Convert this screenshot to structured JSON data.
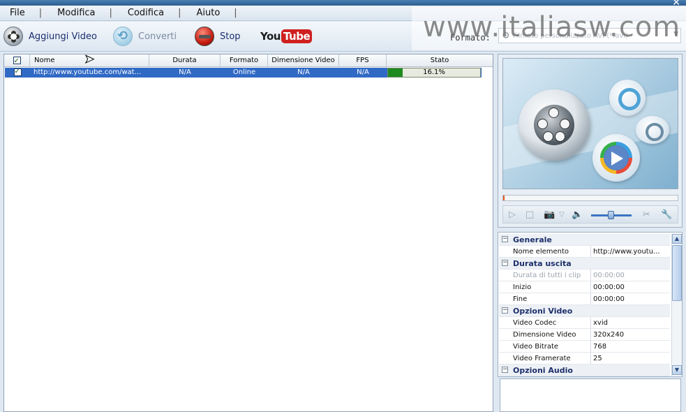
{
  "menu": {
    "items": [
      "File",
      "Modifica",
      "Codifica",
      "Aiuto"
    ],
    "separator": "|"
  },
  "toolbar": {
    "add_video": "Aggiungi Video",
    "convert": "Converti",
    "stop": "Stop",
    "youtube_you": "You",
    "youtube_tube": "Tube"
  },
  "format": {
    "label": "Formato:",
    "value": "Filmato personalizzato AVI (*.avi)"
  },
  "watermark": "www.italiasw.com",
  "list": {
    "columns": [
      "Nome",
      "Durata",
      "Formato",
      "Dimensione Video",
      "FPS",
      "Stato"
    ],
    "rows": [
      {
        "name": "http://www.youtube.com/wat...",
        "duration": "N/A",
        "format": "Online",
        "size": "N/A",
        "fps": "N/A",
        "status": "16.1%",
        "progress": 0.161
      }
    ]
  },
  "properties": {
    "general": {
      "title": "Generale",
      "item_name_key": "Nome elemento",
      "item_name_val": "http://www.youtu..."
    },
    "output_duration": {
      "title": "Durata uscita",
      "all_clips_key": "Durata di tutti i clip",
      "all_clips_val": "00:00:00",
      "start_key": "Inizio",
      "start_val": "00:00:00",
      "end_key": "Fine",
      "end_val": "00:00:00"
    },
    "video": {
      "title": "Opzioni Video",
      "codec_key": "Video Codec",
      "codec_val": "xvid",
      "size_key": "Dimensione Video",
      "size_val": "320x240",
      "bitrate_key": "Video Bitrate",
      "bitrate_val": "768",
      "framerate_key": "Video Framerate",
      "framerate_val": "25"
    },
    "audio": {
      "title": "Opzioni Audio"
    }
  },
  "colors": {
    "selection": "#316ac5",
    "progress": "#1f8a1f",
    "accent_text": "#1a2d6e"
  }
}
